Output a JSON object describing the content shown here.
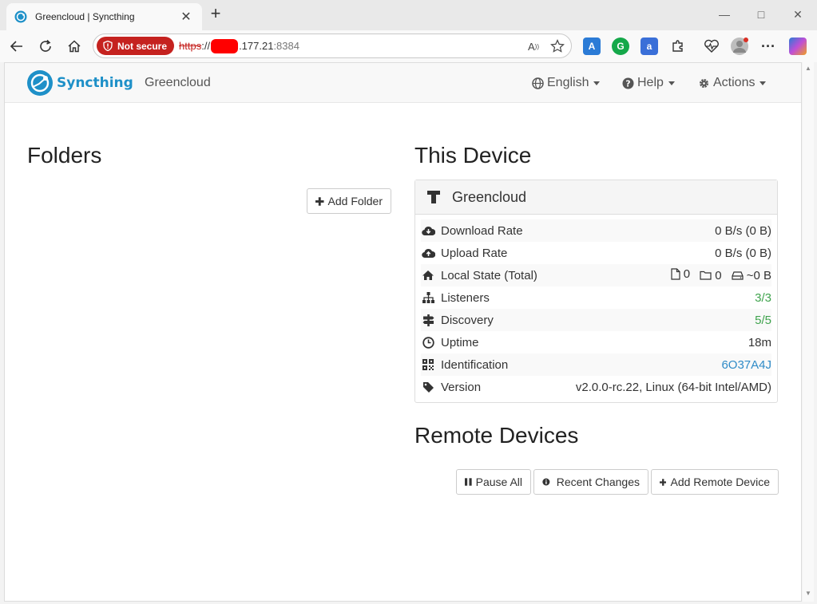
{
  "browser": {
    "tab_title": "Greencloud | Syncthing",
    "not_secure_label": "Not secure",
    "url_scheme": "https",
    "url_sep": "://",
    "url_host": ".177.21",
    "url_port": ":8384"
  },
  "navbar": {
    "brand": "Syncthing",
    "device_name": "Greencloud",
    "language": "English",
    "help": "Help",
    "actions": "Actions"
  },
  "folders": {
    "heading": "Folders",
    "add_folder": "Add Folder"
  },
  "this_device": {
    "heading": "This Device",
    "name": "Greencloud",
    "rows": [
      {
        "label": "Download Rate",
        "value": "0 B/s (0 B)"
      },
      {
        "label": "Upload Rate",
        "value": "0 B/s (0 B)"
      },
      {
        "label": "Local State (Total)",
        "files": "0",
        "dirs": "0",
        "size": "~0 B"
      },
      {
        "label": "Listeners",
        "value": "3/3"
      },
      {
        "label": "Discovery",
        "value": "5/5"
      },
      {
        "label": "Uptime",
        "value": "18m"
      },
      {
        "label": "Identification",
        "value": "6O37A4J"
      },
      {
        "label": "Version",
        "value": "v2.0.0-rc.22, Linux (64-bit Intel/AMD)"
      }
    ]
  },
  "remote_devices": {
    "heading": "Remote Devices",
    "pause_all": "Pause All",
    "recent_changes": "Recent Changes",
    "add_remote_device": "Add Remote Device"
  },
  "colors": {
    "brand": "#1e90c8",
    "ok_green": "#3fa34d",
    "link_blue": "#2f8bc7",
    "not_secure_red": "#c5221f"
  }
}
